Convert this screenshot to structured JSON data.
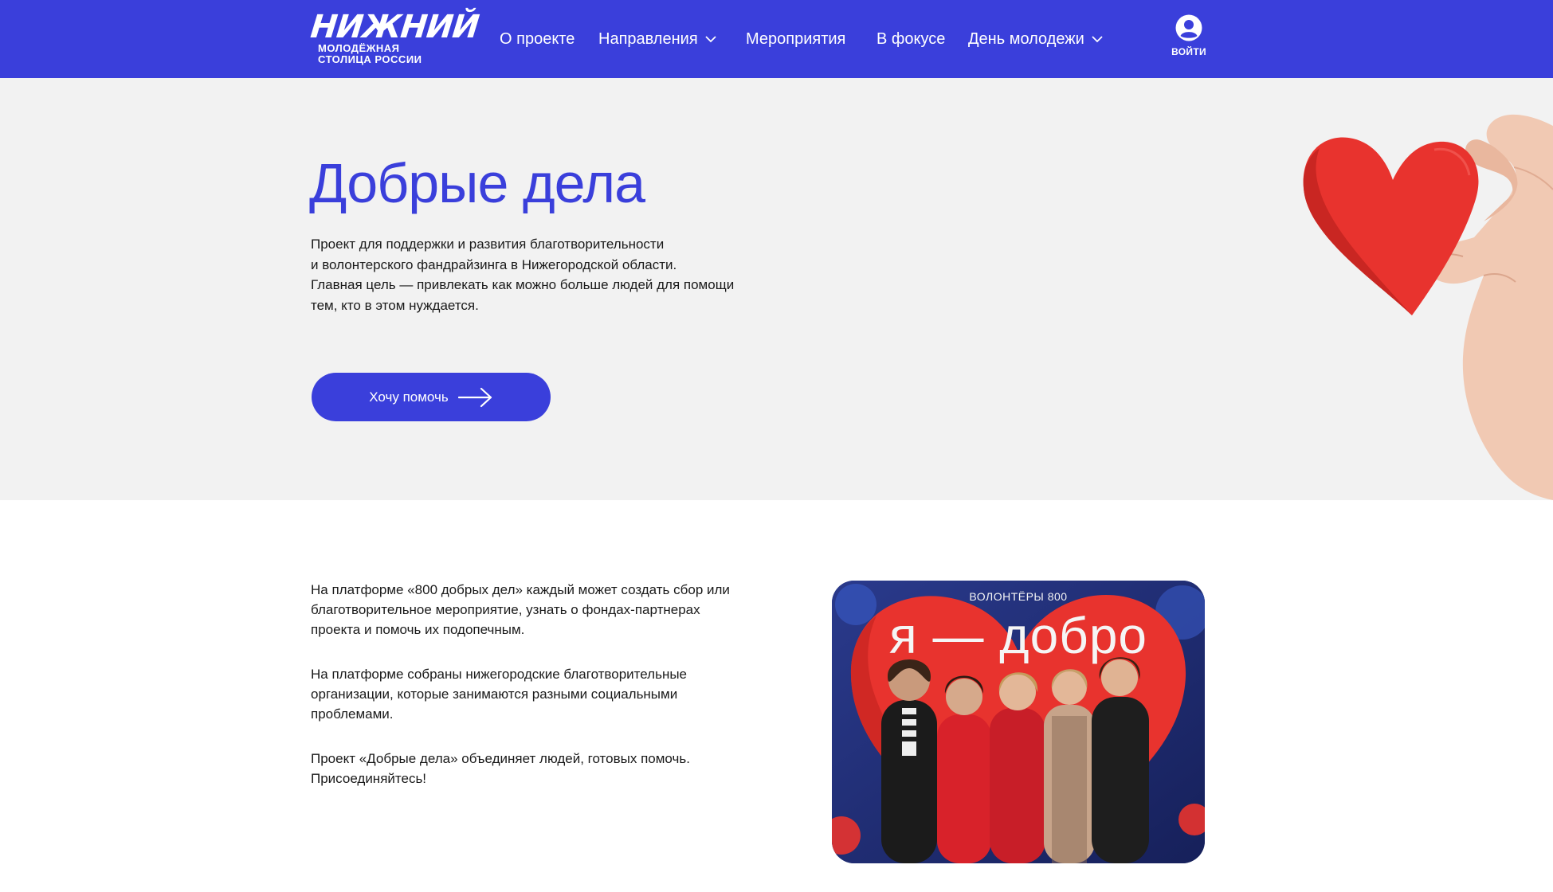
{
  "brand": {
    "logo_word": "НИЖНИЙ",
    "logo_line1": "МОЛОДЁЖНАЯ",
    "logo_line2": "СТОЛИЦА РОССИИ"
  },
  "nav": {
    "items": [
      {
        "label": "О проекте",
        "has_dropdown": false
      },
      {
        "label": "Направления",
        "has_dropdown": true
      },
      {
        "label": "Мероприятия",
        "has_dropdown": false
      },
      {
        "label": "В фокусе",
        "has_dropdown": false
      },
      {
        "label": "День молодежи",
        "has_dropdown": true
      }
    ],
    "login_label": "ВОЙТИ"
  },
  "hero": {
    "title": "Добрые дела",
    "description_lines": [
      "Проект для поддержки и развития благотворительности",
      "и волонтерского фандрайзинга в Нижегородской области.",
      "Главная цель — привлекать как можно больше людей для помощи",
      "тем, кто в этом нуждается."
    ],
    "cta_label": "Хочу помочь"
  },
  "content": {
    "paragraphs": [
      [
        "На платформе «800 добрых дел» каждый может создать сбор или",
        "благотворительное мероприятие, узнать о фондах-партнерах",
        "проекта и помочь их подопечным."
      ],
      [
        "На платформе собраны нижегородские благотворительные",
        "организации, которые занимаются разными социальными",
        "проблемами."
      ],
      [
        "Проект «Добрые дела» объединяет людей, готовых помочь.",
        "Присоединяйтесь!"
      ]
    ],
    "photo_caption": "ВОЛОНТЁРЫ 800",
    "photo_title": "я — добро"
  },
  "colors": {
    "brand_blue": "#3a3fdb",
    "hero_bg": "#f2f2f2",
    "heart_red": "#e8332e"
  },
  "icons": {
    "login": "user-circle-icon",
    "cta": "arrow-right-icon",
    "dropdown": "chevron-down-icon"
  }
}
